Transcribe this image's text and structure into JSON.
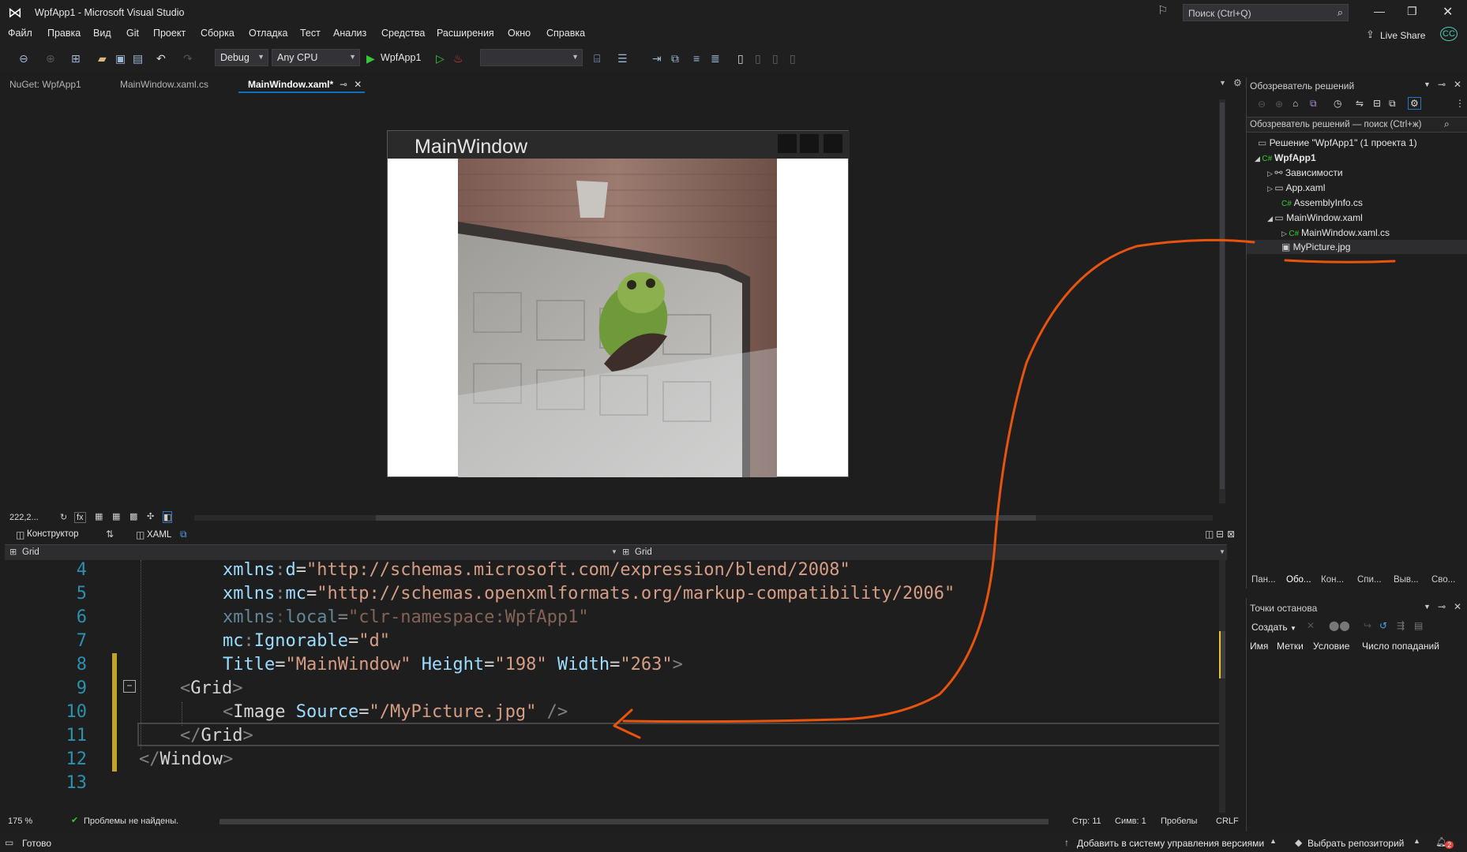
{
  "window": {
    "title": "WpfApp1 - Microsoft Visual Studio",
    "search_placeholder": "Поиск (Ctrl+Q)",
    "live_share": "Live Share",
    "user_initials": "CC"
  },
  "menu": [
    "Файл",
    "Правка",
    "Вид",
    "Git",
    "Проект",
    "Сборка",
    "Отладка",
    "Тест",
    "Анализ",
    "Средства",
    "Расширения",
    "Окно",
    "Справка"
  ],
  "toolbar": {
    "config": "Debug",
    "platform": "Any CPU",
    "run_target": "WpfApp1"
  },
  "doc_tabs": [
    "NuGet: WpfApp1",
    "MainWindow.xaml.cs",
    "MainWindow.xaml*"
  ],
  "designer": {
    "wpf_title": "MainWindow",
    "zoom": "222,2...",
    "tab_designer": "Конструктор",
    "tab_xaml": "XAML"
  },
  "breadcrumbs": {
    "left": "Grid",
    "right": "Grid"
  },
  "code": {
    "line_numbers": [
      "4",
      "5",
      "6",
      "7",
      "8",
      "9",
      "10",
      "11",
      "12",
      "13"
    ]
  },
  "editor_status": {
    "zoom": "175 %",
    "issues": "Проблемы не найдены.",
    "line": "Стр: 11",
    "col": "Симв: 1",
    "spaces": "Пробелы",
    "eol": "CRLF"
  },
  "solution_explorer": {
    "title": "Обозреватель решений",
    "search": "Обозреватель решений — поиск (Ctrl+ж)",
    "items": [
      "Решение \"WpfApp1\"  (1 проекта 1)",
      "WpfApp1",
      "Зависимости",
      "App.xaml",
      "AssemblyInfo.cs",
      "MainWindow.xaml",
      "MainWindow.xaml.cs",
      "MyPicture.jpg"
    ],
    "bottom_tabs": [
      "Пан...",
      "Обо...",
      "Кон...",
      "Спи...",
      "Выв...",
      "Сво..."
    ]
  },
  "breakpoints": {
    "title": "Точки останова",
    "create": "Создать",
    "columns": [
      "Имя",
      "Метки",
      "Условие",
      "Число попаданий"
    ]
  },
  "status": {
    "ready": "Готово",
    "add_vcs": "Добавить в систему управления версиями",
    "select_repo": "Выбрать репозиторий",
    "notifications": "2"
  },
  "colors": {
    "accent": "#0e70c0",
    "annotation": "#e8530e",
    "bg": "#1e1e1e"
  }
}
